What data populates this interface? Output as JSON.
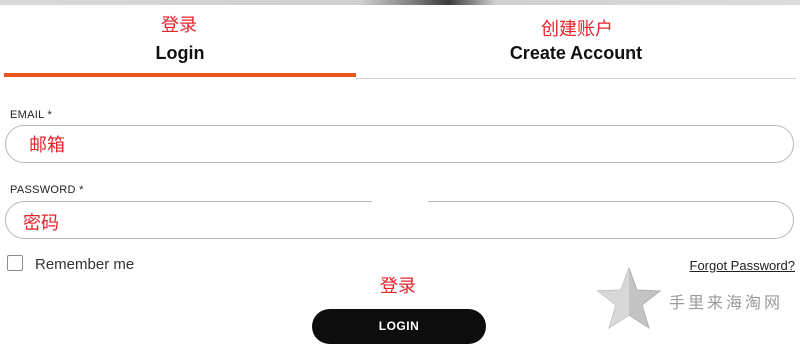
{
  "annotations": {
    "login_tab_cn": "登录",
    "create_tab_cn": "创建账户",
    "email_cn": "邮箱",
    "password_cn": "密码",
    "login_button_cn": "登录"
  },
  "tabs": [
    {
      "label": "Login",
      "active": true
    },
    {
      "label": "Create Account",
      "active": false
    }
  ],
  "form": {
    "email_label": "EMAIL *",
    "email_value": "",
    "password_label": "PASSWORD *",
    "password_value": "",
    "remember_label": "Remember me",
    "remember_checked": false,
    "forgot_label": "Forgot Password?",
    "submit_label": "LOGIN"
  },
  "watermark": "手里来海淘网",
  "colors": {
    "accent": "#e8551f",
    "annotation": "#e8232a",
    "button_bg": "#0d0d0d",
    "field_border": "#b8b8b8"
  },
  "icons": {
    "watermark": "star-icon"
  }
}
